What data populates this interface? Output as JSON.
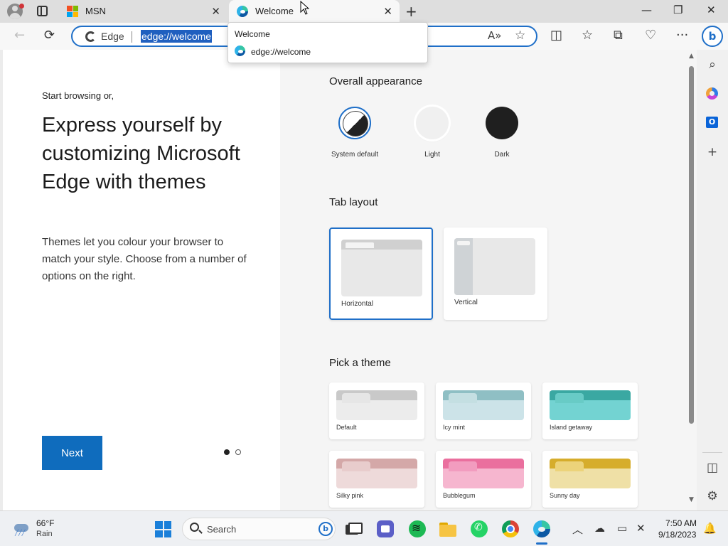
{
  "tabs": [
    {
      "title": "MSN",
      "close": "✕",
      "icon": "msn-icon"
    },
    {
      "title": "Welcome",
      "close": "✕",
      "icon": "edge-icon",
      "active": true
    }
  ],
  "tabstrip": {
    "new_tab": "+",
    "minimize": "—",
    "restore": "❐",
    "close": "✕"
  },
  "toolbar": {
    "back": "←",
    "refresh": "⟳",
    "address": {
      "site_label": "Edge",
      "url": "edge://welcome"
    },
    "read_aloud": "A»",
    "favorite": "☆",
    "split": "◫",
    "favorites": "☆",
    "collections": "⧉",
    "performance": "♡",
    "more": "···",
    "copilot": "b"
  },
  "tooltip": {
    "title": "Welcome",
    "url": "edge://welcome"
  },
  "left": {
    "intro": "Start browsing or,",
    "headline": "Express yourself by customizing Microsoft Edge with themes",
    "description": "Themes let you colour your browser to match your style. Choose from a number of options on the right.",
    "next_label": "Next",
    "pager": {
      "current": 1,
      "total": 2
    }
  },
  "appearance": {
    "title": "Overall appearance",
    "options": [
      {
        "label": "System default",
        "selected": true
      },
      {
        "label": "Light",
        "selected": false
      },
      {
        "label": "Dark",
        "selected": false
      }
    ]
  },
  "tab_layout": {
    "title": "Tab layout",
    "options": [
      {
        "label": "Horizontal",
        "selected": true
      },
      {
        "label": "Vertical",
        "selected": false
      }
    ]
  },
  "themes": {
    "title": "Pick a theme",
    "items": [
      {
        "label": "Default",
        "bar": "#c9c9c9",
        "body": "#ececec",
        "folder": "#e6e6e6"
      },
      {
        "label": "Icy mint",
        "bar": "#8fbfc4",
        "body": "#cce3e8",
        "folder": "#c4dfe2"
      },
      {
        "label": "Island getaway",
        "bar": "#3aa8a2",
        "body": "#73d3d2",
        "folder": "#68cbc6"
      },
      {
        "label": "Silky pink",
        "bar": "#d4a8a8",
        "body": "#eedada",
        "folder": "#e8cccc"
      },
      {
        "label": "Bubblegum",
        "bar": "#ea6f9e",
        "body": "#f6b6cf",
        "folder": "#f29cbf"
      },
      {
        "label": "Sunny day",
        "bar": "#d6ad2c",
        "body": "#efe0a6",
        "folder": "#ecd37a"
      }
    ]
  },
  "sidebar": {
    "search": "⌕",
    "add": "+",
    "panel": "◫",
    "settings": "⚙",
    "outlook": "O"
  },
  "taskbar": {
    "weather": {
      "temp": "66°F",
      "condition": "Rain"
    },
    "search_placeholder": "Search",
    "search_bing": "b",
    "tray": {
      "chevron": "︿",
      "cloud": "☁",
      "display": "▭",
      "speaker": "✕"
    },
    "time": "7:50 AM",
    "date": "9/18/2023",
    "notification": "🔔"
  },
  "colors": {
    "accent": "#0f6cbd",
    "selected_border": "#1f6fc8"
  }
}
